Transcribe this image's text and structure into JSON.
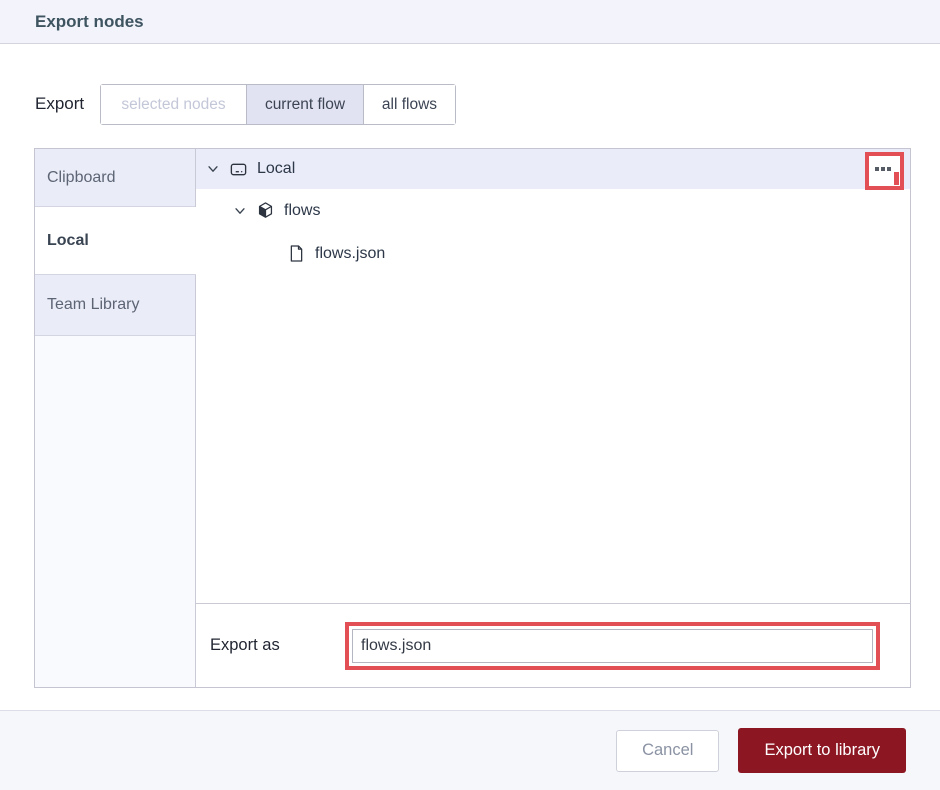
{
  "colors": {
    "annotation-red": "#e25056",
    "primary-button": "#8c1723",
    "selected-row-bg": "#eaecf9",
    "tab-bg": "#eaecf8",
    "header-bg": "#f3f4fb",
    "footer-bg": "#f6f7fa",
    "selected-toggle-bg": "#e1e3f2"
  },
  "header": {
    "title": "Export nodes"
  },
  "export_scope": {
    "label": "Export",
    "options": [
      {
        "label": "selected nodes",
        "state": "disabled"
      },
      {
        "label": "current flow",
        "state": "selected"
      },
      {
        "label": "all flows",
        "state": "normal"
      }
    ]
  },
  "library": {
    "tabs": [
      {
        "label": "Clipboard",
        "state": "normal"
      },
      {
        "label": "Local",
        "state": "active"
      },
      {
        "label": "Team Library",
        "state": "normal"
      }
    ],
    "tree": {
      "rows": [
        {
          "label": "Local",
          "icon": "hard-drive-icon",
          "expanded": true,
          "selected": true,
          "depth": 0
        },
        {
          "label": "flows",
          "icon": "package-icon",
          "expanded": true,
          "selected": false,
          "depth": 1
        },
        {
          "label": "flows.json",
          "icon": "file-icon",
          "selected": false,
          "depth": 2
        }
      ],
      "menu_icon": "ellipsis-icon",
      "menu_highlighted": true
    },
    "export_as": {
      "label": "Export as",
      "value": "flows.json",
      "highlighted": true
    }
  },
  "footer": {
    "cancel_label": "Cancel",
    "submit_label": "Export to library"
  }
}
